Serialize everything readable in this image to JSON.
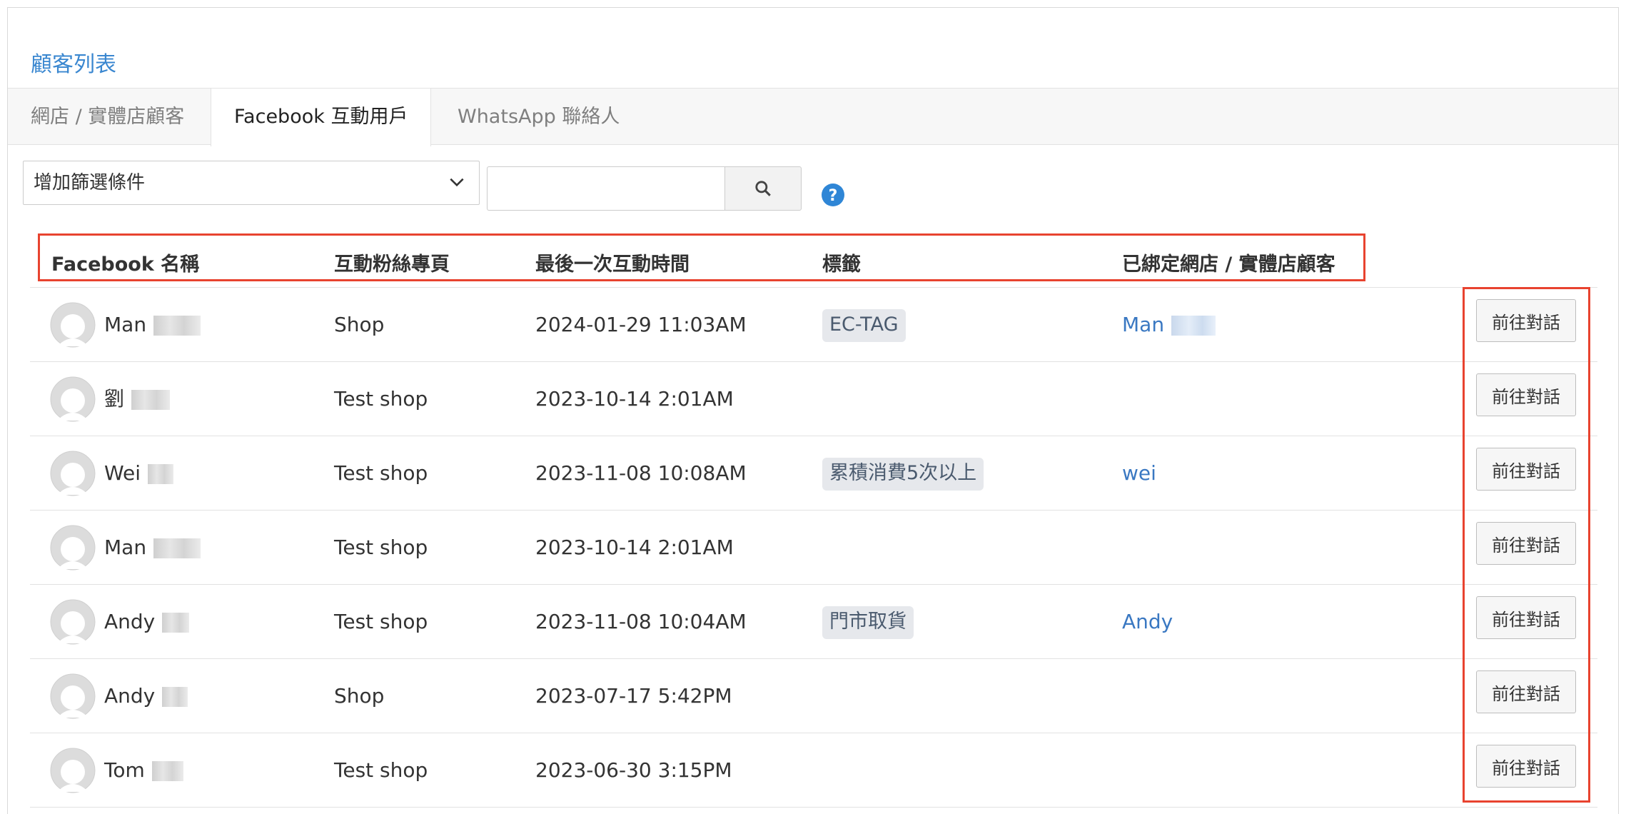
{
  "page": {
    "title": "顧客列表"
  },
  "tabs": [
    {
      "label": "網店 / 實體店顧客",
      "active": false
    },
    {
      "label": "Facebook 互動用戶",
      "active": true
    },
    {
      "label": "WhatsApp 聯絡人",
      "active": false
    }
  ],
  "filter": {
    "select_label": "增加篩選條件",
    "search_value": "",
    "search_placeholder": ""
  },
  "icons": {
    "search": "search-icon",
    "help": "help-icon",
    "dropdown": "chevron-down-icon",
    "avatar": "user-avatar-icon"
  },
  "colors": {
    "accent": "#3a87d0",
    "highlight": "#e8432f",
    "tag_bg": "#e6e8ec"
  },
  "table": {
    "headers": [
      "Facebook 名稱",
      "互動粉絲專頁",
      "最後一次互動時間",
      "標籤",
      "已綁定網店 / 實體店顧客"
    ],
    "action_label": "前往對話",
    "rows": [
      {
        "name": "Man",
        "page": "Shop",
        "time": "2024-01-29 11:03AM",
        "tag": "EC-TAG",
        "bound": "Man"
      },
      {
        "name": "劉",
        "page": "Test shop",
        "time": "2023-10-14 2:01AM",
        "tag": "",
        "bound": ""
      },
      {
        "name": "Wei",
        "page": "Test shop",
        "time": "2023-11-08 10:08AM",
        "tag": "累積消費5次以上",
        "bound": "wei"
      },
      {
        "name": "Man",
        "page": "Test shop",
        "time": "2023-10-14 2:01AM",
        "tag": "",
        "bound": ""
      },
      {
        "name": "Andy",
        "page": "Test shop",
        "time": "2023-11-08 10:04AM",
        "tag": "門市取貨",
        "bound": "Andy"
      },
      {
        "name": "Andy",
        "page": "Shop",
        "time": "2023-07-17 5:42PM",
        "tag": "",
        "bound": ""
      },
      {
        "name": "Tom",
        "page": "Test shop",
        "time": "2023-06-30 3:15PM",
        "tag": "",
        "bound": ""
      }
    ]
  }
}
